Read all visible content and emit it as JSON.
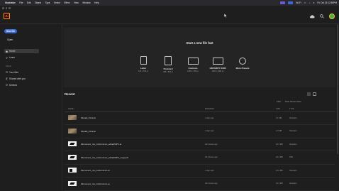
{
  "menubar": {
    "apple_glyph": "",
    "items": [
      "Illustrator",
      "File",
      "Edit",
      "Object",
      "Type",
      "Select",
      "Effect",
      "View",
      "Window",
      "Help"
    ],
    "tray": {
      "wifi": "Wi-Fi",
      "time": "Fri Oct 25 12:55PM"
    }
  },
  "app": {
    "logo_text": "Ai",
    "avatar_initial": ""
  },
  "sidebar": {
    "new_file_label": "New file",
    "open_label": "Open",
    "items": [
      {
        "label": "Home",
        "active": true
      },
      {
        "label": "Learn",
        "active": false
      }
    ],
    "files_section": "FILES",
    "file_items": [
      {
        "label": "Your files"
      },
      {
        "label": "Shared with you"
      },
      {
        "label": "Deleted"
      }
    ]
  },
  "create": {
    "title": "Start a new file fast",
    "presets": [
      {
        "name": "Letter",
        "size": "612 x 792 pt"
      },
      {
        "name": "Postcard",
        "size": "288 x 560 pt"
      },
      {
        "name": "Common",
        "size": "1366 x 768 px"
      },
      {
        "name": "HDV/HDTV 1080",
        "size": "1920 x 1080 px"
      },
      {
        "name": "More Presets",
        "size": ""
      }
    ]
  },
  "recent": {
    "title": "Recent",
    "filter_label": "Filter",
    "filter_placeholder": "Filter Recent Files",
    "columns": {
      "name": "NAME",
      "modified": "MODIFIED",
      "size": "SIZE",
      "type": "TYPE"
    },
    "files": [
      {
        "name": "Mosaik_Final.ai",
        "modified": "4 days ago",
        "size": "2.1 MB",
        "type": "Illustrator",
        "thumb": "photo"
      },
      {
        "name": "Mosaik_Final.ai",
        "modified": "4 days ago",
        "size": "2.3 MB",
        "type": "Illustrator",
        "thumb": "photo"
      },
      {
        "name": "Monument_ms_rodcommon_editedMPC.ai",
        "modified": "29 minutes ago",
        "size": "22.4 MB",
        "type": "Illustrator",
        "thumb": "doc"
      },
      {
        "name": "Monument_ms_rodcommon_editedMPC_copy.pdf",
        "modified": "19 minutes ago",
        "size": "22.4 MB",
        "type": "PDF",
        "thumb": "doc"
      },
      {
        "name": "Monument_ms_rodcommon.ai",
        "modified": "4 days ago",
        "size": "12.0 MB",
        "type": "Illustrator",
        "thumb": "dark"
      },
      {
        "name": "Monument_ms_rodcommon.ai",
        "modified": "48 minutes ago",
        "size": "22.4 MB",
        "type": "Illustrator",
        "thumb": "doc"
      }
    ]
  },
  "colors": {
    "accent": "#3a6bd9",
    "ai_orange": "#ff9a00",
    "ai_bg": "#330000"
  }
}
